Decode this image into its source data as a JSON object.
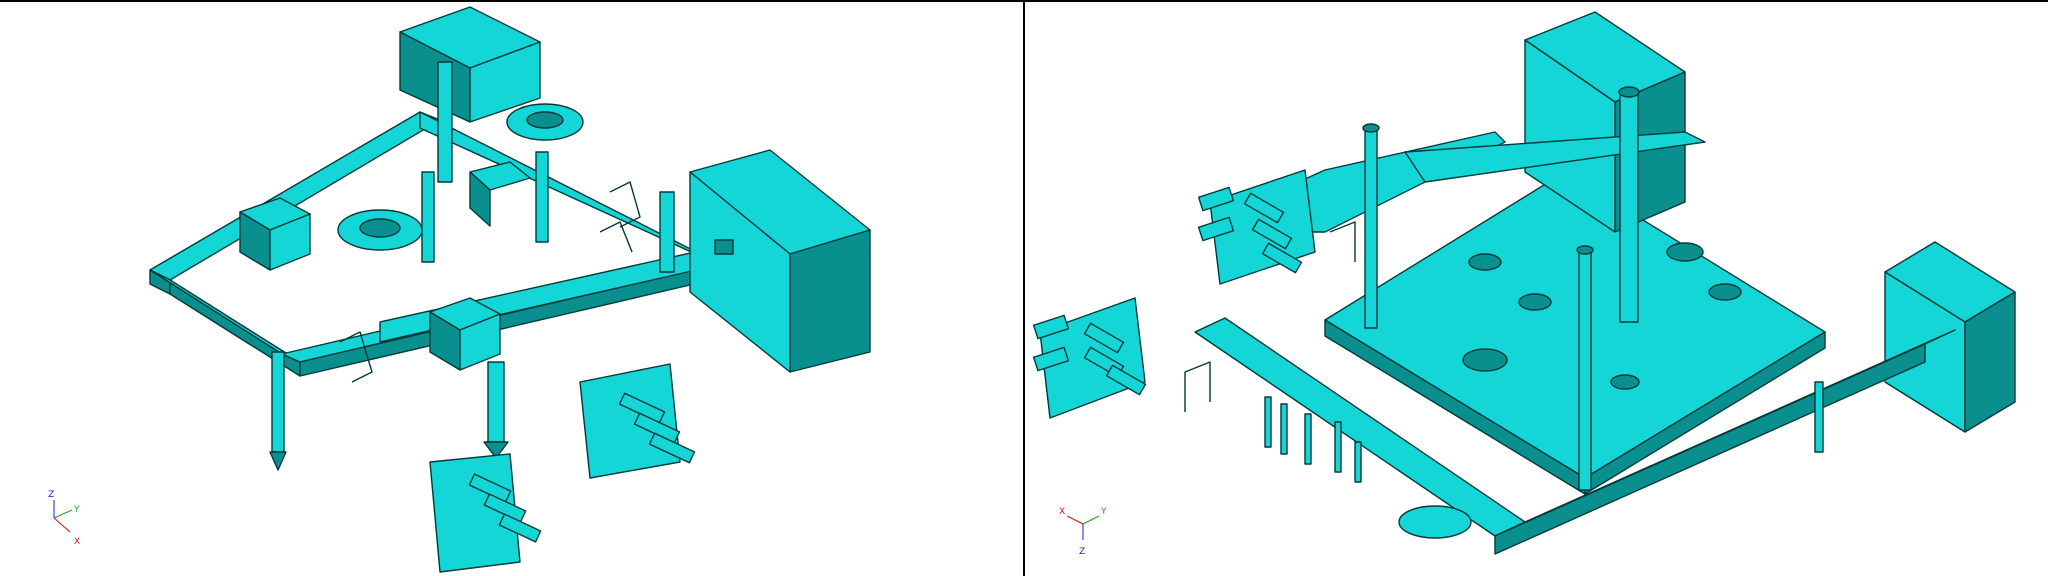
{
  "colors": {
    "model_fill": "#15d6d6",
    "model_dark": "#0a8f8f",
    "model_edge": "#003a3a",
    "axis_x": "#e11010",
    "axis_y": "#1fa01f",
    "axis_z": "#1a1ae0"
  },
  "viewports": [
    {
      "triad": {
        "x_label": "X",
        "y_label": "Y",
        "z_label": "Z"
      }
    },
    {
      "triad": {
        "x_label": "X",
        "y_label": "Y",
        "z_label": "Z"
      }
    }
  ]
}
